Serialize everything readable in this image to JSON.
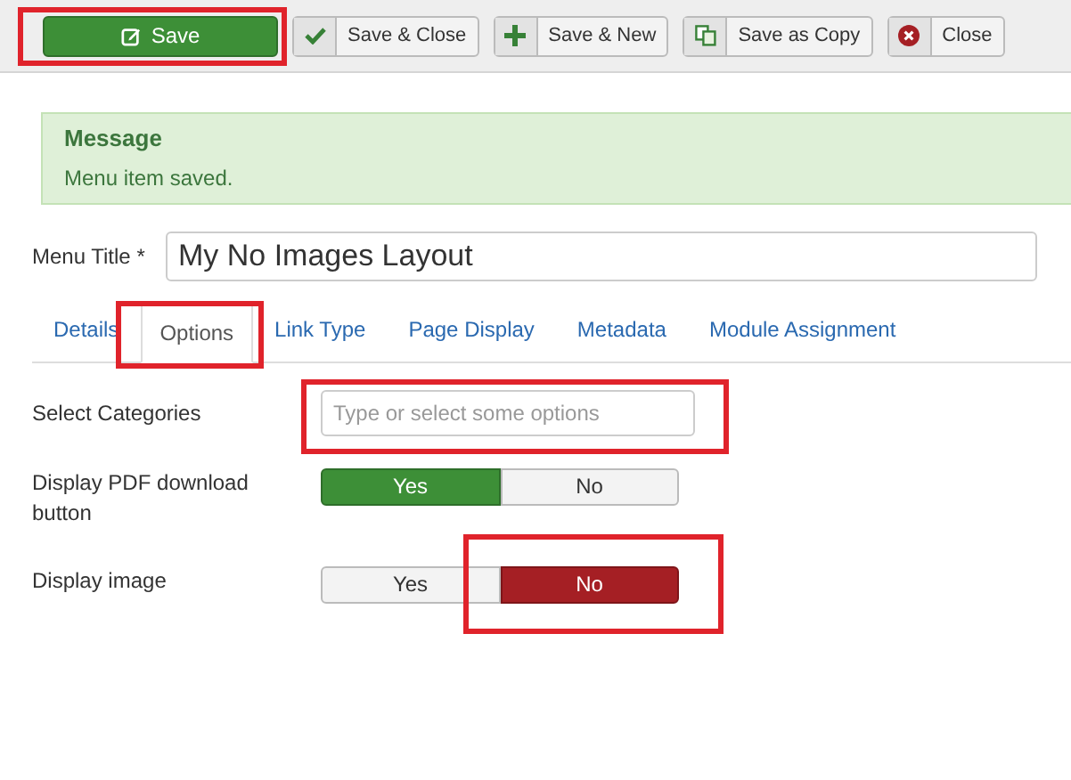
{
  "toolbar": [
    {
      "label": "Save",
      "kind": "primary",
      "highlighted": true
    },
    {
      "label": "Save & Close",
      "kind": "default",
      "highlighted": false
    },
    {
      "label": "Save & New",
      "kind": "default",
      "highlighted": false
    },
    {
      "label": "Save as Copy",
      "kind": "default",
      "highlighted": false
    },
    {
      "label": "Close",
      "kind": "default",
      "highlighted": false
    }
  ],
  "message": {
    "heading": "Message",
    "text": "Menu item saved."
  },
  "menu_title": {
    "label": "Menu Title *",
    "value": "My No Images Layout"
  },
  "tabs": [
    {
      "label": "Details",
      "selected": false,
      "highlighted": false
    },
    {
      "label": "Options",
      "selected": true,
      "highlighted": true
    },
    {
      "label": "Link Type",
      "selected": false,
      "highlighted": false
    },
    {
      "label": "Page Display",
      "selected": false,
      "highlighted": false
    },
    {
      "label": "Metadata",
      "selected": false,
      "highlighted": false
    },
    {
      "label": "Module Assignment",
      "selected": false,
      "highlighted": false
    }
  ],
  "fields": [
    {
      "kind": "select",
      "label": "Select Categories",
      "placeholder": "Type or select some options",
      "highlighted": true
    },
    {
      "kind": "toggle",
      "label": "Display PDF download button",
      "options": [
        {
          "label": "Yes",
          "kind": "yes",
          "selected": true,
          "highlighted": false
        },
        {
          "label": "No",
          "kind": "no",
          "selected": false,
          "highlighted": false
        }
      ]
    },
    {
      "kind": "toggle",
      "label": "Display image",
      "options": [
        {
          "label": "Yes",
          "kind": "yes",
          "selected": false,
          "highlighted": false
        },
        {
          "label": "No",
          "kind": "no",
          "selected": true,
          "highlighted": true
        }
      ]
    }
  ]
}
